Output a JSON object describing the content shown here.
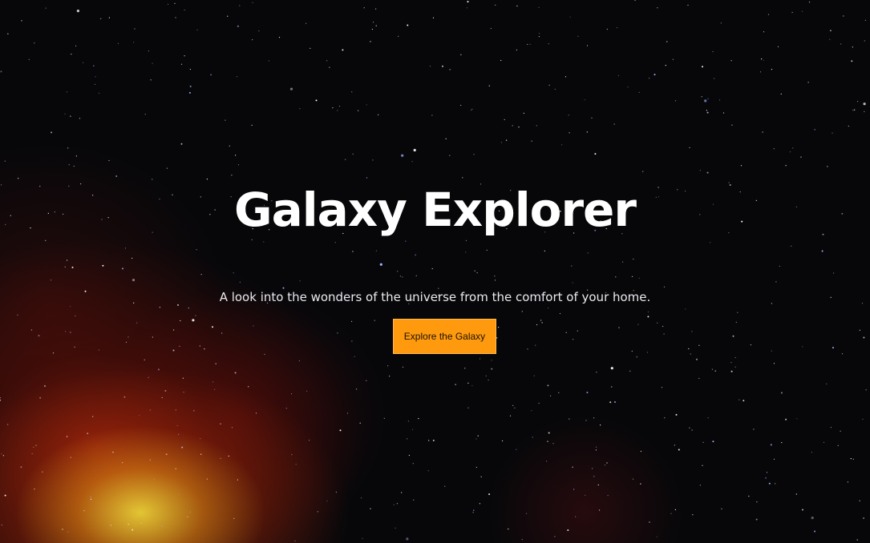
{
  "hero": {
    "title": "Galaxy Explorer",
    "subtitle": "A look into the wonders of the universe from the comfort of your home.",
    "cta_label": "Explore the Galaxy"
  },
  "colors": {
    "background": "#07070a",
    "text": "#ffffff",
    "cta_background": "#ff9a0e",
    "cta_text": "#1a1206"
  }
}
